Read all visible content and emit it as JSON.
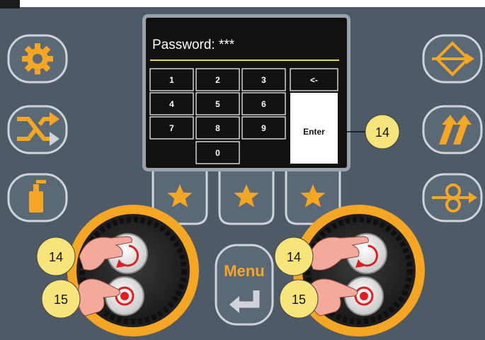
{
  "colors": {
    "panel": "#4e5a66",
    "button_bg": "#5b6875",
    "button_border": "#d0d4d8",
    "accent": "#f5a623",
    "screen_bg": "#111111",
    "callout_fill": "#f7e47a",
    "hand": "#f4a99a",
    "press_red": "#e02020"
  },
  "screen": {
    "password_label": "Password: ***",
    "keypad": {
      "keys": [
        "1",
        "2",
        "3",
        "4",
        "5",
        "6",
        "7",
        "8",
        "9",
        "0"
      ],
      "backspace": "<-",
      "enter": "Enter"
    }
  },
  "left_buttons": [
    {
      "icon": "gear-icon"
    },
    {
      "icon": "shuffle-icon"
    },
    {
      "icon": "spray-can-icon"
    }
  ],
  "right_buttons": [
    {
      "icon": "diamond-arrow-icon"
    },
    {
      "icon": "double-arrow-icon"
    },
    {
      "icon": "wire-feed-icon"
    }
  ],
  "favorites": [
    "star-icon",
    "star-icon",
    "star-icon"
  ],
  "menu_button": {
    "label": "Menu",
    "icon": "return-arrow-icon"
  },
  "callouts": {
    "enter_callout": "14",
    "left_turn": "14",
    "left_press": "15",
    "right_turn": "14",
    "right_press": "15"
  }
}
